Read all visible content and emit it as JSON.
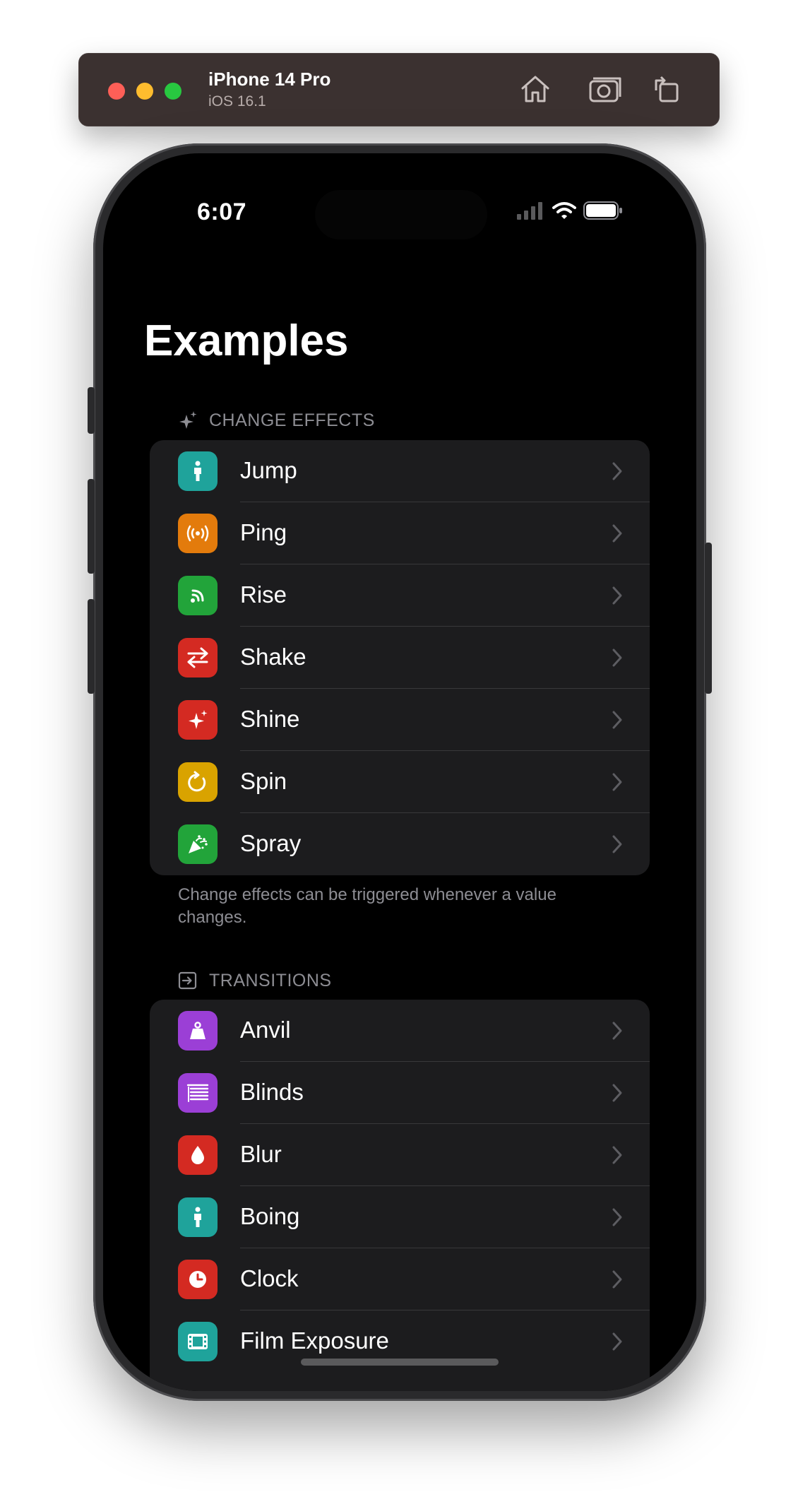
{
  "simulator": {
    "device_name": "iPhone 14 Pro",
    "os_version": "iOS 16.1",
    "icons": [
      "home-icon",
      "screenshot-icon",
      "rotate-icon"
    ]
  },
  "status_bar": {
    "time": "6:07"
  },
  "page": {
    "title": "Examples"
  },
  "sections": [
    {
      "header": "CHANGE EFFECTS",
      "header_icon": "sparkles-icon",
      "items": [
        {
          "label": "Jump",
          "icon": "figure-icon",
          "color": "#1fa39b"
        },
        {
          "label": "Ping",
          "icon": "broadcast-icon",
          "color": "#e37b0c"
        },
        {
          "label": "Rise",
          "icon": "signal-icon",
          "color": "#22a43a"
        },
        {
          "label": "Shake",
          "icon": "arrows-icon",
          "color": "#d42a22"
        },
        {
          "label": "Shine",
          "icon": "sparkle-icon",
          "color": "#d42a22"
        },
        {
          "label": "Spin",
          "icon": "rotate-arrow-icon",
          "color": "#d9a300"
        },
        {
          "label": "Spray",
          "icon": "party-popper-icon",
          "color": "#22a43a"
        }
      ],
      "footer": "Change effects can be triggered whenever a value changes."
    },
    {
      "header": "TRANSITIONS",
      "header_icon": "enter-box-icon",
      "items": [
        {
          "label": "Anvil",
          "icon": "weight-icon",
          "color": "#9b3fd6"
        },
        {
          "label": "Blinds",
          "icon": "list-icon",
          "color": "#9b3fd6"
        },
        {
          "label": "Blur",
          "icon": "drop-icon",
          "color": "#d42a22"
        },
        {
          "label": "Boing",
          "icon": "figure-icon",
          "color": "#1fa39b"
        },
        {
          "label": "Clock",
          "icon": "clock-icon",
          "color": "#d42a22"
        },
        {
          "label": "Film Exposure",
          "icon": "film-icon",
          "color": "#1fa39b"
        }
      ]
    }
  ]
}
